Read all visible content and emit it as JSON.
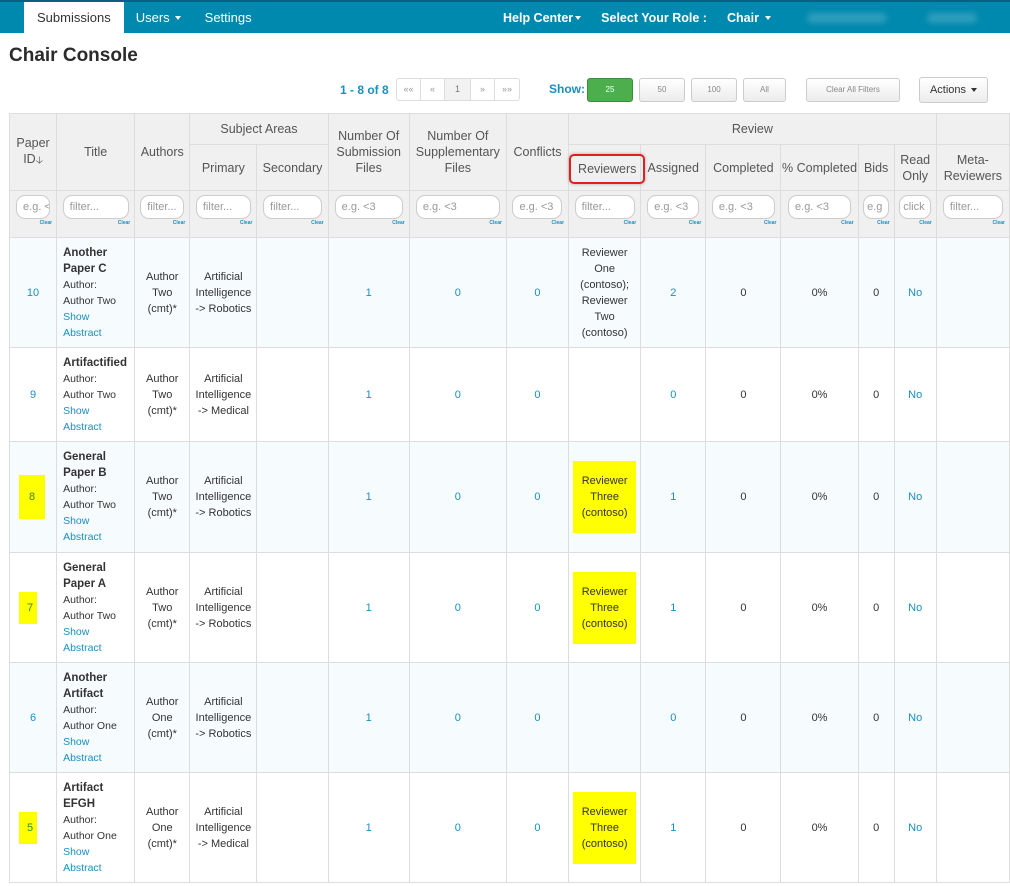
{
  "navbar": {
    "tabs": [
      {
        "label": "Submissions",
        "active": true
      },
      {
        "label": "Users",
        "dropdown": true
      },
      {
        "label": "Settings"
      }
    ],
    "help_center": "Help Center",
    "role_label": "Select Your Role :",
    "role_value": "Chair"
  },
  "page": {
    "title": "Chair Console"
  },
  "toolbar": {
    "count": "1 - 8 of 8",
    "pager": {
      "first": "««",
      "prev": "«",
      "current": "1",
      "next": "»",
      "last": "»»"
    },
    "show_label": "Show:",
    "page_sizes": [
      "25",
      "50",
      "100",
      "All"
    ],
    "selected_page_size": "25",
    "clear_filters": "Clear All Filters",
    "actions": "Actions"
  },
  "table": {
    "group_headers": {
      "subject_areas": "Subject Areas",
      "review": "Review"
    },
    "columns": {
      "paper_id": "Paper ID",
      "title": "Title",
      "authors": "Authors",
      "primary": "Primary",
      "secondary": "Secondary",
      "submission_files": "Number Of Submission Files",
      "supplementary_files": "Number Of Supplementary Files",
      "conflicts": "Conflicts",
      "reviewers": "Reviewers",
      "assigned": "Assigned",
      "completed": "Completed",
      "pct_completed": "% Completed",
      "bids": "Bids",
      "read_only": "Read Only",
      "meta_reviewers": "Meta-Reviewers"
    },
    "filters": {
      "paper_id": "e.g. <",
      "title": "filter...",
      "authors": "filter...",
      "primary": "filter...",
      "secondary": "filter...",
      "submission_files": "e.g. <3",
      "supplementary_files": "e.g. <3",
      "conflicts": "e.g. <3",
      "reviewers": "filter...",
      "assigned": "e.g. <3",
      "completed": "e.g. <3",
      "pct_completed": "e.g. <3",
      "bids": "e.g",
      "read_only": "click",
      "meta_reviewers": "filter...",
      "clear_label": "Clear"
    },
    "author_label": "Author:",
    "show_abstract": "Show Abstract",
    "rows": [
      {
        "id": "10",
        "title": "Another Paper C",
        "author": "Author Two",
        "authors": "Author Two (cmt)*",
        "primary": "Artificial Intelligence -> Robotics",
        "secondary": "",
        "submission_files": "1",
        "supplementary_files": "0",
        "conflicts": "0",
        "reviewers": "Reviewer One (contoso); Reviewer Two (contoso)",
        "assigned": "2",
        "completed": "0",
        "pct_completed": "0%",
        "bids": "0",
        "read_only": "No",
        "meta_reviewers": "",
        "highlight_id": false,
        "highlight_reviewers": false
      },
      {
        "id": "9",
        "title": "Artifactified",
        "author": "Author Two",
        "authors": "Author Two (cmt)*",
        "primary": "Artificial Intelligence -> Medical",
        "secondary": "",
        "submission_files": "1",
        "supplementary_files": "0",
        "conflicts": "0",
        "reviewers": "",
        "assigned": "0",
        "completed": "0",
        "pct_completed": "0%",
        "bids": "0",
        "read_only": "No",
        "meta_reviewers": "",
        "highlight_id": false,
        "highlight_reviewers": false
      },
      {
        "id": "8",
        "title": "General Paper B",
        "author": "Author Two",
        "authors": "Author Two (cmt)*",
        "primary": "Artificial Intelligence -> Robotics",
        "secondary": "",
        "submission_files": "1",
        "supplementary_files": "0",
        "conflicts": "0",
        "reviewers": "Reviewer Three (contoso)",
        "assigned": "1",
        "completed": "0",
        "pct_completed": "0%",
        "bids": "0",
        "read_only": "No",
        "meta_reviewers": "",
        "highlight_id": true,
        "highlight_reviewers": true
      },
      {
        "id": "7",
        "title": "General Paper A",
        "author": "Author Two",
        "authors": "Author Two (cmt)*",
        "primary": "Artificial Intelligence -> Robotics",
        "secondary": "",
        "submission_files": "1",
        "supplementary_files": "0",
        "conflicts": "0",
        "reviewers": "Reviewer Three (contoso)",
        "assigned": "1",
        "completed": "0",
        "pct_completed": "0%",
        "bids": "0",
        "read_only": "No",
        "meta_reviewers": "",
        "highlight_id": true,
        "highlight_reviewers": true
      },
      {
        "id": "6",
        "title": "Another Artifact",
        "author": "Author One",
        "authors": "Author One (cmt)*",
        "primary": "Artificial Intelligence -> Robotics",
        "secondary": "",
        "submission_files": "1",
        "supplementary_files": "0",
        "conflicts": "0",
        "reviewers": "",
        "assigned": "0",
        "completed": "0",
        "pct_completed": "0%",
        "bids": "0",
        "read_only": "No",
        "meta_reviewers": "",
        "highlight_id": false,
        "highlight_reviewers": false
      },
      {
        "id": "5",
        "title": "Artifact EFGH",
        "author": "Author One",
        "authors": "Author One (cmt)*",
        "primary": "Artificial Intelligence -> Medical",
        "secondary": "",
        "submission_files": "1",
        "supplementary_files": "0",
        "conflicts": "0",
        "reviewers": "Reviewer Three (contoso)",
        "assigned": "1",
        "completed": "0",
        "pct_completed": "0%",
        "bids": "0",
        "read_only": "No",
        "meta_reviewers": "",
        "highlight_id": true,
        "highlight_reviewers": true
      }
    ]
  },
  "colors": {
    "navbar": "#0089ae",
    "link": "#1a8fc0",
    "highlight": "#ffff00",
    "callout": "#e02020",
    "show_active": "#4cae4c"
  }
}
